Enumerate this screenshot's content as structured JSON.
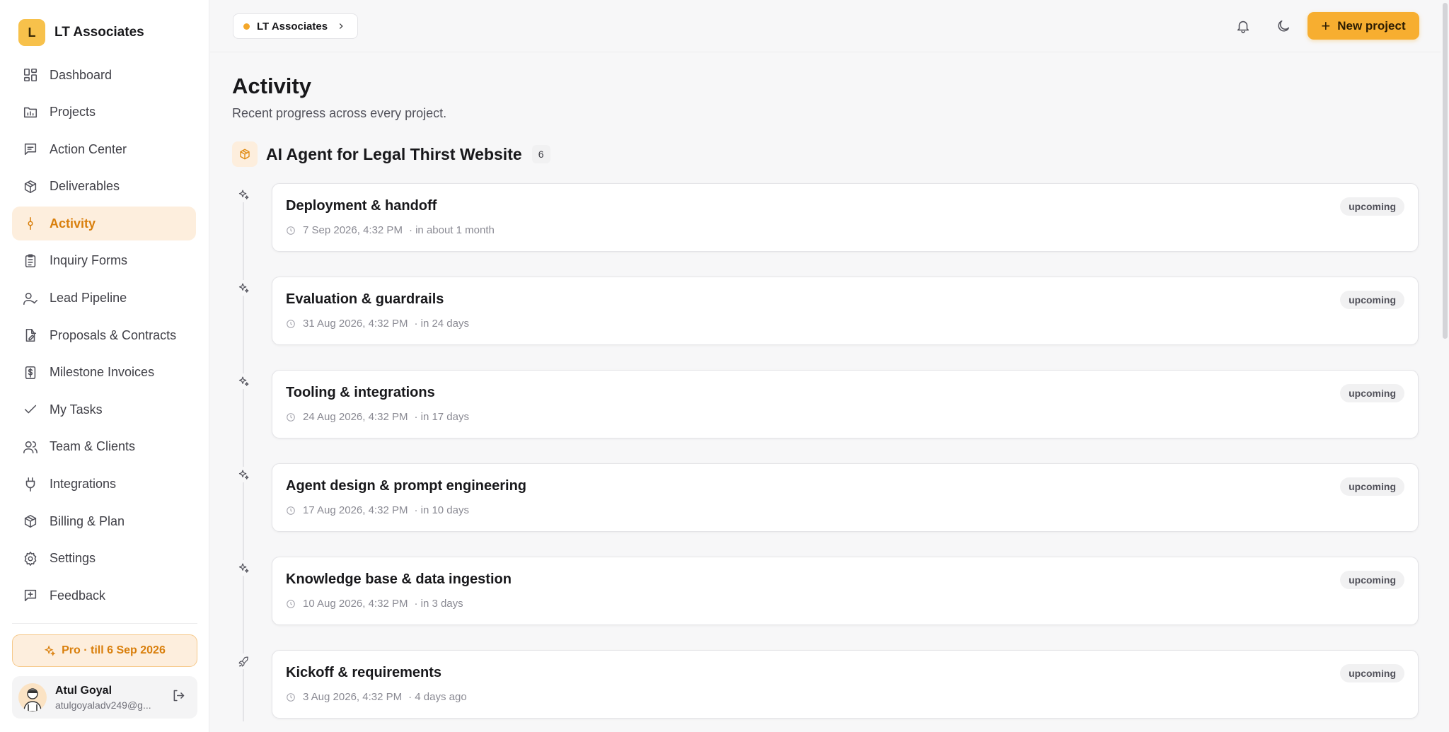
{
  "sidebar": {
    "brand_initial": "L",
    "brand_name": "LT Associates",
    "nav": [
      {
        "label": "Dashboard",
        "icon": "dashboard-icon"
      },
      {
        "label": "Projects",
        "icon": "chart-folder-icon"
      },
      {
        "label": "Action Center",
        "icon": "message-square-icon"
      },
      {
        "label": "Deliverables",
        "icon": "package-icon"
      },
      {
        "label": "Activity",
        "icon": "git-commit-icon",
        "active": true
      },
      {
        "label": "Inquiry Forms",
        "icon": "clipboard-icon"
      },
      {
        "label": "Lead Pipeline",
        "icon": "user-check-icon"
      },
      {
        "label": "Proposals & Contracts",
        "icon": "file-pen-icon"
      },
      {
        "label": "Milestone Invoices",
        "icon": "receipt-dollar-icon"
      },
      {
        "label": "My Tasks",
        "icon": "check-icon"
      },
      {
        "label": "Team & Clients",
        "icon": "users-icon"
      },
      {
        "label": "Integrations",
        "icon": "plug-icon"
      },
      {
        "label": "Billing & Plan",
        "icon": "package-icon"
      },
      {
        "label": "Settings",
        "icon": "gear-icon"
      },
      {
        "label": "Feedback",
        "icon": "message-plus-icon"
      }
    ],
    "plan_badge": "Pro · till 6 Sep 2026",
    "user": {
      "name": "Atul Goyal",
      "email": "atulgoyaladv249@g..."
    }
  },
  "topbar": {
    "workspace": "LT Associates",
    "new_project_label": "New project"
  },
  "main": {
    "title": "Activity",
    "subtitle": "Recent progress across every project.",
    "project": {
      "name": "AI Agent for Legal Thirst Website",
      "count": "6"
    },
    "items": [
      {
        "title": "Deployment & handoff",
        "date": "7 Sep 2026, 4:32 PM",
        "relative": "· in about 1 month",
        "status": "upcoming",
        "icon": "sparkles-icon"
      },
      {
        "title": "Evaluation & guardrails",
        "date": "31 Aug 2026, 4:32 PM",
        "relative": "· in 24 days",
        "status": "upcoming",
        "icon": "sparkles-icon"
      },
      {
        "title": "Tooling & integrations",
        "date": "24 Aug 2026, 4:32 PM",
        "relative": "· in 17 days",
        "status": "upcoming",
        "icon": "sparkles-icon"
      },
      {
        "title": "Agent design & prompt engineering",
        "date": "17 Aug 2026, 4:32 PM",
        "relative": "· in 10 days",
        "status": "upcoming",
        "icon": "sparkles-icon"
      },
      {
        "title": "Knowledge base & data ingestion",
        "date": "10 Aug 2026, 4:32 PM",
        "relative": "· in 3 days",
        "status": "upcoming",
        "icon": "sparkles-icon"
      },
      {
        "title": "Kickoff & requirements",
        "date": "3 Aug 2026, 4:32 PM",
        "relative": "· 4 days ago",
        "status": "upcoming",
        "icon": "rocket-icon"
      }
    ]
  },
  "colors": {
    "accent": "#f7ae30",
    "active_bg": "#fdeedd",
    "active_text": "#d97f0c"
  }
}
